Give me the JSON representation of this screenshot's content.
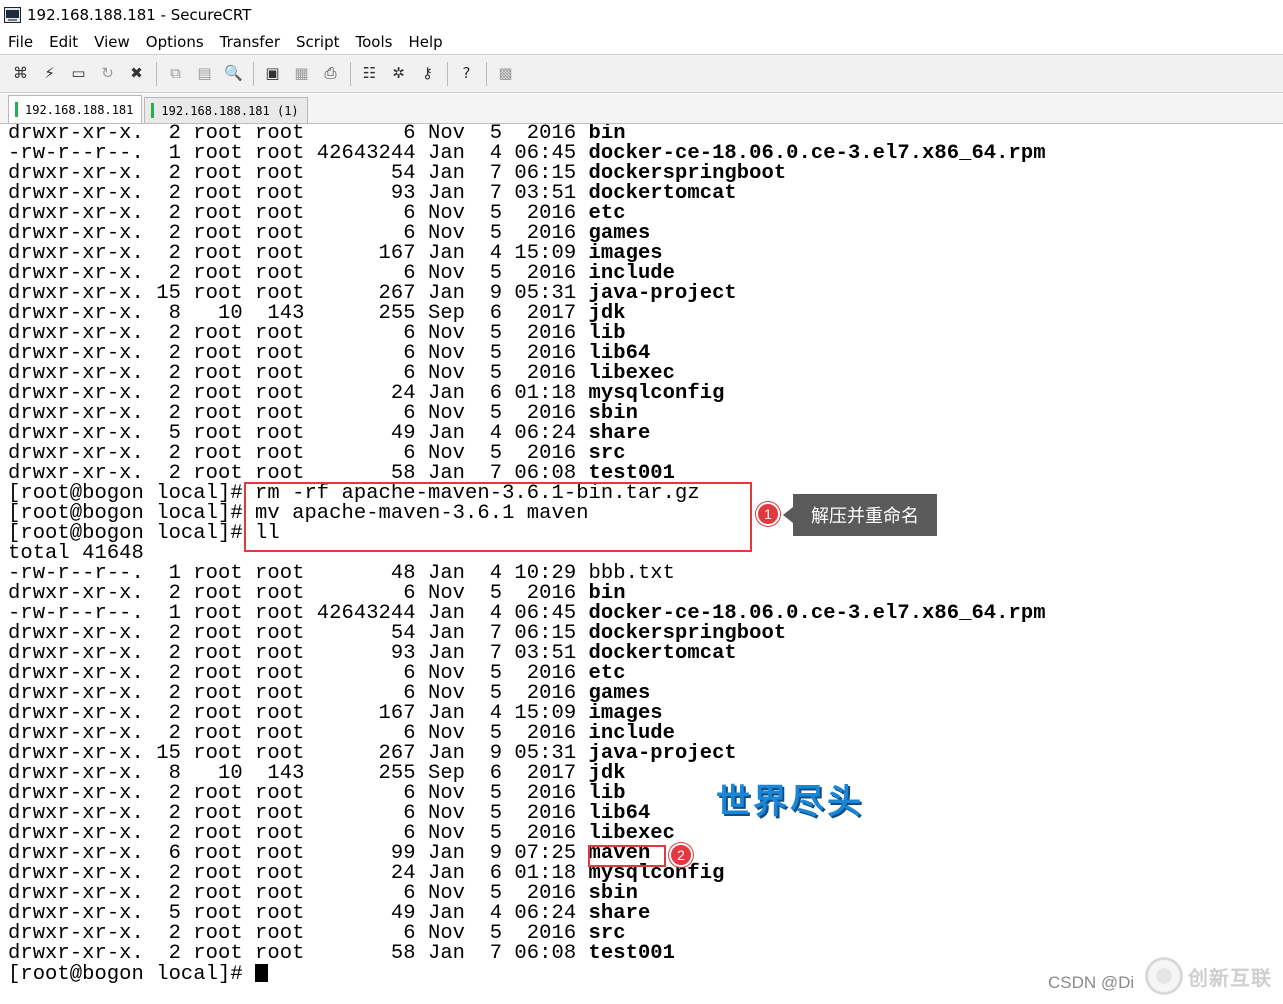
{
  "window": {
    "title": "192.168.188.181 - SecureCRT"
  },
  "menu": [
    "File",
    "Edit",
    "View",
    "Options",
    "Transfer",
    "Script",
    "Tools",
    "Help"
  ],
  "toolbar": {
    "groups": [
      [
        {
          "name": "connect-icon",
          "glyph": "⌘"
        },
        {
          "name": "quick-connect-icon",
          "glyph": "⚡"
        },
        {
          "name": "connect-tab-icon",
          "glyph": "▭"
        },
        {
          "name": "reconnect-icon",
          "glyph": "↻",
          "dim": true
        },
        {
          "name": "disconnect-icon",
          "glyph": "✖"
        }
      ],
      [
        {
          "name": "copy-icon",
          "glyph": "⧉",
          "dim": true
        },
        {
          "name": "paste-icon",
          "glyph": "▤",
          "dim": true
        },
        {
          "name": "find-icon",
          "glyph": "🔍"
        }
      ],
      [
        {
          "name": "print-screen-icon",
          "glyph": "▣"
        },
        {
          "name": "print-selection-icon",
          "glyph": "▦",
          "dim": true
        },
        {
          "name": "print-icon",
          "glyph": "⎙"
        }
      ],
      [
        {
          "name": "session-options-icon",
          "glyph": "☷"
        },
        {
          "name": "global-options-icon",
          "glyph": "✲"
        },
        {
          "name": "keymap-icon",
          "glyph": "⚷"
        }
      ],
      [
        {
          "name": "help-icon",
          "glyph": "?"
        }
      ],
      [
        {
          "name": "sftp-icon",
          "glyph": "▩",
          "dim": true
        }
      ]
    ]
  },
  "tabs": [
    {
      "label": "192.168.188.181",
      "active": true
    },
    {
      "label": "192.168.188.181 (1)",
      "active": false
    }
  ],
  "terminal": {
    "lines": [
      {
        "prefix": "drwxr-xr-x.  2 root root        6 Nov  5  2016 ",
        "name": "bin"
      },
      {
        "prefix": "-rw-r--r--.  1 root root 42643244 Jan  4 06:45 ",
        "name": "docker-ce-18.06.0.ce-3.el7.x86_64.rpm"
      },
      {
        "prefix": "drwxr-xr-x.  2 root root       54 Jan  7 06:15 ",
        "name": "dockerspringboot"
      },
      {
        "prefix": "drwxr-xr-x.  2 root root       93 Jan  7 03:51 ",
        "name": "dockertomcat"
      },
      {
        "prefix": "drwxr-xr-x.  2 root root        6 Nov  5  2016 ",
        "name": "etc"
      },
      {
        "prefix": "drwxr-xr-x.  2 root root        6 Nov  5  2016 ",
        "name": "games"
      },
      {
        "prefix": "drwxr-xr-x.  2 root root      167 Jan  4 15:09 ",
        "name": "images"
      },
      {
        "prefix": "drwxr-xr-x.  2 root root        6 Nov  5  2016 ",
        "name": "include"
      },
      {
        "prefix": "drwxr-xr-x. 15 root root      267 Jan  9 05:31 ",
        "name": "java-project"
      },
      {
        "prefix": "drwxr-xr-x.  8   10  143      255 Sep  6  2017 ",
        "name": "jdk"
      },
      {
        "prefix": "drwxr-xr-x.  2 root root        6 Nov  5  2016 ",
        "name": "lib"
      },
      {
        "prefix": "drwxr-xr-x.  2 root root        6 Nov  5  2016 ",
        "name": "lib64"
      },
      {
        "prefix": "drwxr-xr-x.  2 root root        6 Nov  5  2016 ",
        "name": "libexec"
      },
      {
        "prefix": "drwxr-xr-x.  2 root root       24 Jan  6 01:18 ",
        "name": "mysqlconfig"
      },
      {
        "prefix": "drwxr-xr-x.  2 root root        6 Nov  5  2016 ",
        "name": "sbin"
      },
      {
        "prefix": "drwxr-xr-x.  5 root root       49 Jan  4 06:24 ",
        "name": "share"
      },
      {
        "prefix": "drwxr-xr-x.  2 root root        6 Nov  5  2016 ",
        "name": "src"
      },
      {
        "prefix": "drwxr-xr-x.  2 root root       58 Jan  7 06:08 ",
        "name": "test001"
      },
      {
        "prefix": "[root@bogon local]# rm -rf apache-maven-3.6.1-bin.tar.gz",
        "name": ""
      },
      {
        "prefix": "[root@bogon local]# mv apache-maven-3.6.1 maven",
        "name": ""
      },
      {
        "prefix": "[root@bogon local]# ll",
        "name": ""
      },
      {
        "prefix": "total 41648",
        "name": ""
      },
      {
        "prefix": "-rw-r--r--.  1 root root       48 Jan  4 10:29 bbb.txt",
        "name": ""
      },
      {
        "prefix": "drwxr-xr-x.  2 root root        6 Nov  5  2016 ",
        "name": "bin"
      },
      {
        "prefix": "-rw-r--r--.  1 root root 42643244 Jan  4 06:45 ",
        "name": "docker-ce-18.06.0.ce-3.el7.x86_64.rpm"
      },
      {
        "prefix": "drwxr-xr-x.  2 root root       54 Jan  7 06:15 ",
        "name": "dockerspringboot"
      },
      {
        "prefix": "drwxr-xr-x.  2 root root       93 Jan  7 03:51 ",
        "name": "dockertomcat"
      },
      {
        "prefix": "drwxr-xr-x.  2 root root        6 Nov  5  2016 ",
        "name": "etc"
      },
      {
        "prefix": "drwxr-xr-x.  2 root root        6 Nov  5  2016 ",
        "name": "games"
      },
      {
        "prefix": "drwxr-xr-x.  2 root root      167 Jan  4 15:09 ",
        "name": "images"
      },
      {
        "prefix": "drwxr-xr-x.  2 root root        6 Nov  5  2016 ",
        "name": "include"
      },
      {
        "prefix": "drwxr-xr-x. 15 root root      267 Jan  9 05:31 ",
        "name": "java-project"
      },
      {
        "prefix": "drwxr-xr-x.  8   10  143      255 Sep  6  2017 ",
        "name": "jdk"
      },
      {
        "prefix": "drwxr-xr-x.  2 root root        6 Nov  5  2016 ",
        "name": "lib"
      },
      {
        "prefix": "drwxr-xr-x.  2 root root        6 Nov  5  2016 ",
        "name": "lib64"
      },
      {
        "prefix": "drwxr-xr-x.  2 root root        6 Nov  5  2016 ",
        "name": "libexec"
      },
      {
        "prefix": "drwxr-xr-x.  6 root root       99 Jan  9 07:25 ",
        "name": "maven"
      },
      {
        "prefix": "drwxr-xr-x.  2 root root       24 Jan  6 01:18 ",
        "name": "mysqlconfig"
      },
      {
        "prefix": "drwxr-xr-x.  2 root root        6 Nov  5  2016 ",
        "name": "sbin"
      },
      {
        "prefix": "drwxr-xr-x.  5 root root       49 Jan  4 06:24 ",
        "name": "share"
      },
      {
        "prefix": "drwxr-xr-x.  2 root root        6 Nov  5  2016 ",
        "name": "src"
      },
      {
        "prefix": "drwxr-xr-x.  2 root root       58 Jan  7 06:08 ",
        "name": "test001"
      },
      {
        "prefix": "[root@bogon local]# ",
        "name": "",
        "cursor": true
      }
    ]
  },
  "annotations": {
    "badge1": "1",
    "badge2": "2",
    "callout": "解压并重命名",
    "overlay": "世界尽头"
  },
  "watermark": {
    "csdn": "CSDN @Di",
    "brand": "创新互联"
  },
  "colors": {
    "annotation_red": "#e0393e",
    "callout_bg": "#5a5a5a",
    "overlay_blue": "#1a86d6",
    "tab_indicator": "#22b14c"
  }
}
